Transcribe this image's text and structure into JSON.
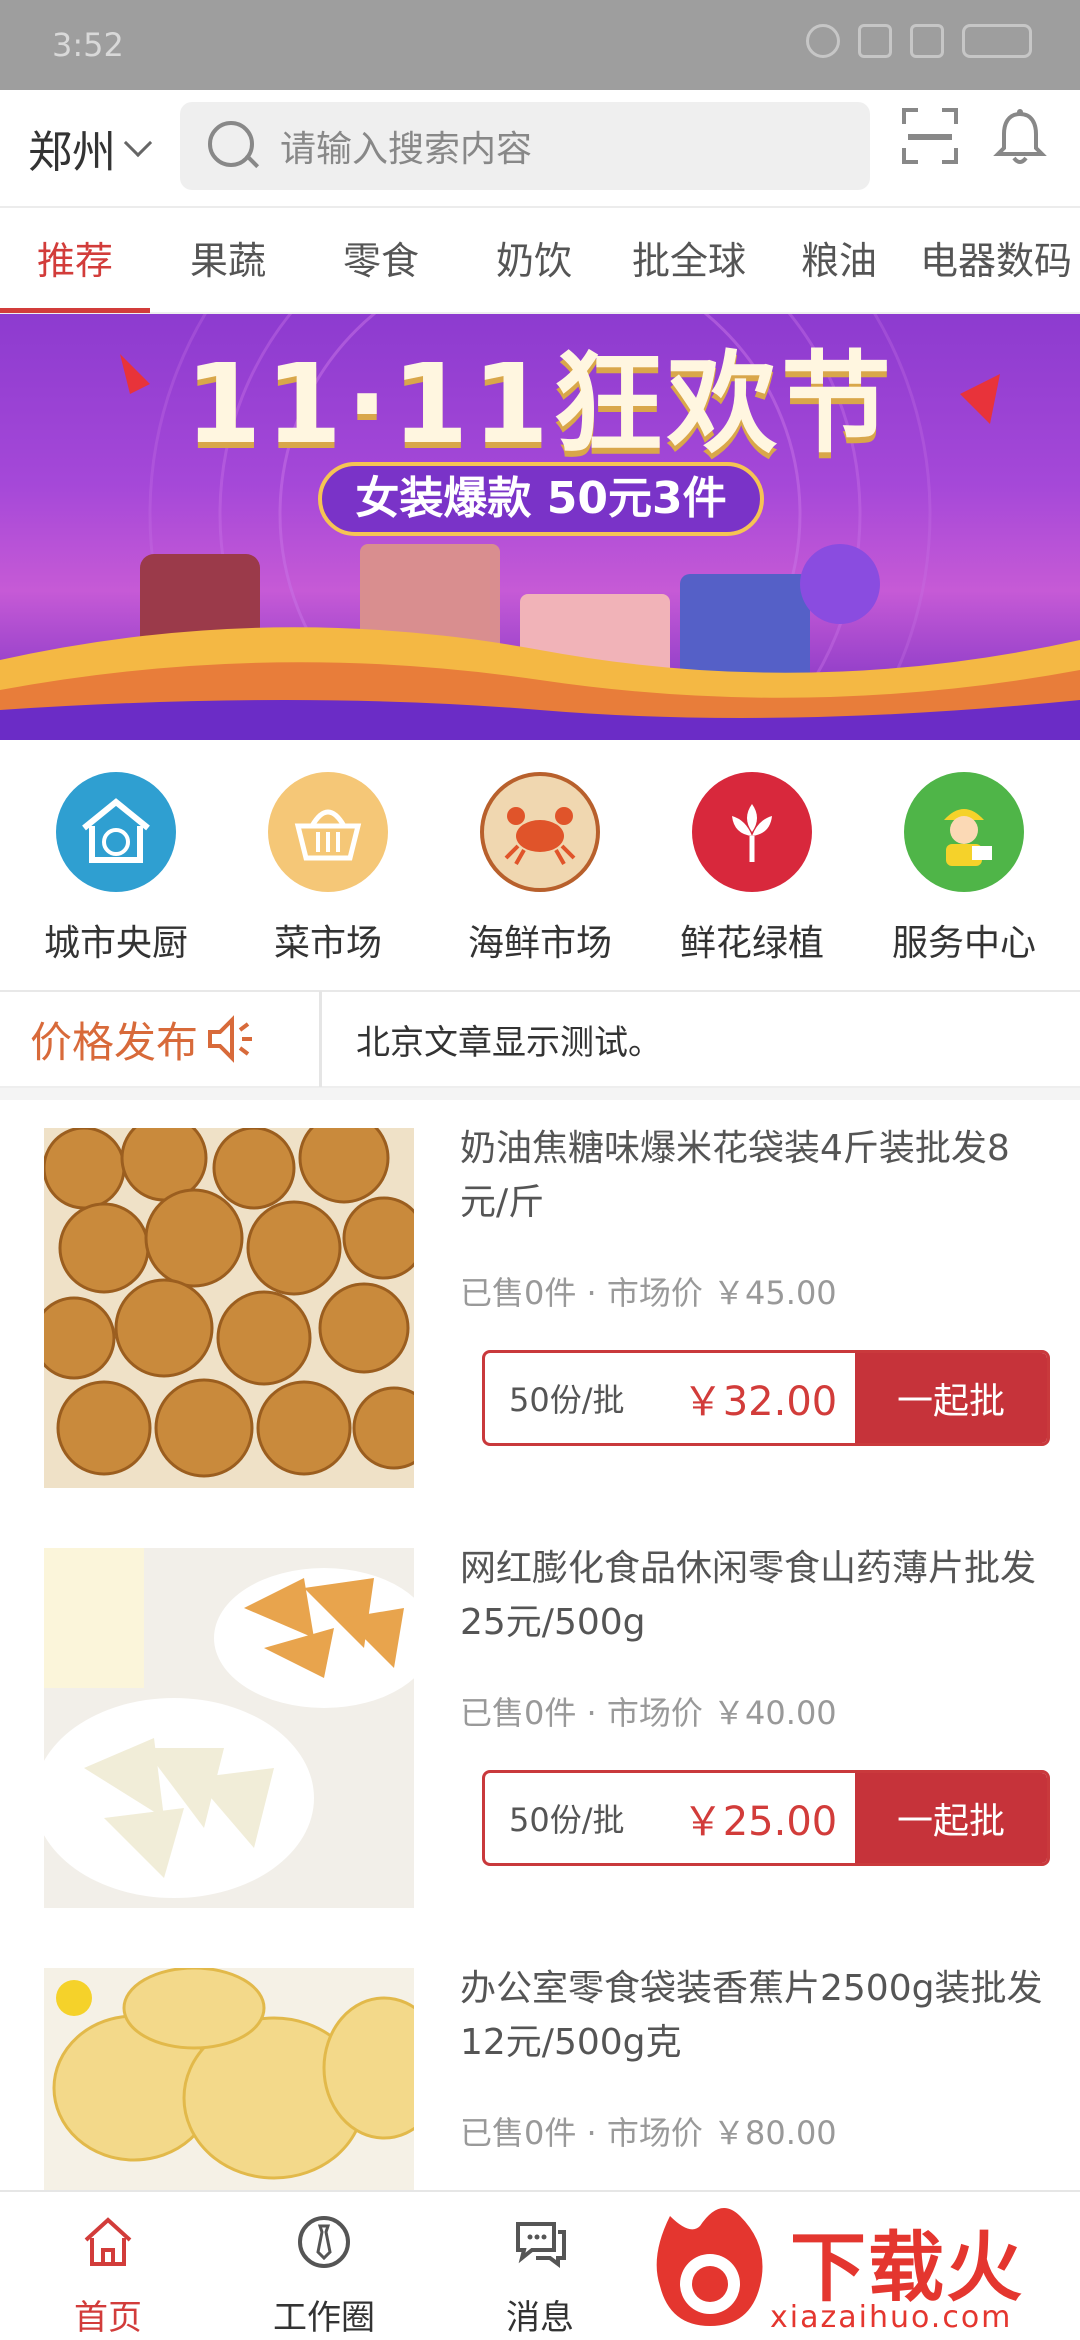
{
  "status_bar": {
    "time": "3:52"
  },
  "header": {
    "city": "郑州",
    "search_placeholder": "请输入搜索内容",
    "scan_icon": "scan-icon",
    "notification_icon": "bell-icon"
  },
  "tabs": [
    {
      "label": "推荐",
      "active": true
    },
    {
      "label": "果蔬"
    },
    {
      "label": "零食"
    },
    {
      "label": "奶饮"
    },
    {
      "label": "批全球"
    },
    {
      "label": "粮油"
    },
    {
      "label": "电器数码"
    }
  ],
  "banner": {
    "title": "11·11狂欢节",
    "subtitle": "女装爆款 50元3件",
    "colors": {
      "bg": "#9a42d4",
      "gold": "#f6c453"
    }
  },
  "quick_entries": [
    {
      "label": "城市央厨",
      "icon": "kitchen-house-icon",
      "color": "#2f9fd1"
    },
    {
      "label": "菜市场",
      "icon": "basket-icon",
      "color": "#f5c777"
    },
    {
      "label": "海鲜市场",
      "icon": "crab-icon",
      "color": "#b8602c"
    },
    {
      "label": "鲜花绿植",
      "icon": "flower-icon",
      "color": "#d8283c"
    },
    {
      "label": "服务中心",
      "icon": "service-worker-icon",
      "color": "#4fb548"
    }
  ],
  "notice": {
    "label": "价格发布",
    "text": "北京文章显示测试。"
  },
  "products": [
    {
      "title": "奶油焦糖味爆米花袋装4斤装批发8元/斤",
      "sold": "已售0件 · 市场价 ￥45.00",
      "batch": "50份/批",
      "price": "￥32.00",
      "button": "一起批"
    },
    {
      "title": "网红膨化食品休闲零食山药薄片批发25元/500g",
      "sold": "已售0件 · 市场价 ￥40.00",
      "batch": "50份/批",
      "price": "￥25.00",
      "button": "一起批"
    },
    {
      "title": "办公室零食袋装香蕉片2500g装批发12元/500g克",
      "sold": "已售0件 · 市场价 ￥80.00"
    }
  ],
  "bottom_nav": [
    {
      "label": "首页",
      "icon": "home-icon",
      "active": true
    },
    {
      "label": "工作圈",
      "icon": "tie-icon"
    },
    {
      "label": "消息",
      "icon": "chat-icon"
    }
  ],
  "watermark": {
    "title": "下载火",
    "url": "xiazaihuo.com"
  },
  "colors": {
    "accent": "#d23c3a",
    "button": "#c6333a",
    "notice": "#d86a3a"
  }
}
